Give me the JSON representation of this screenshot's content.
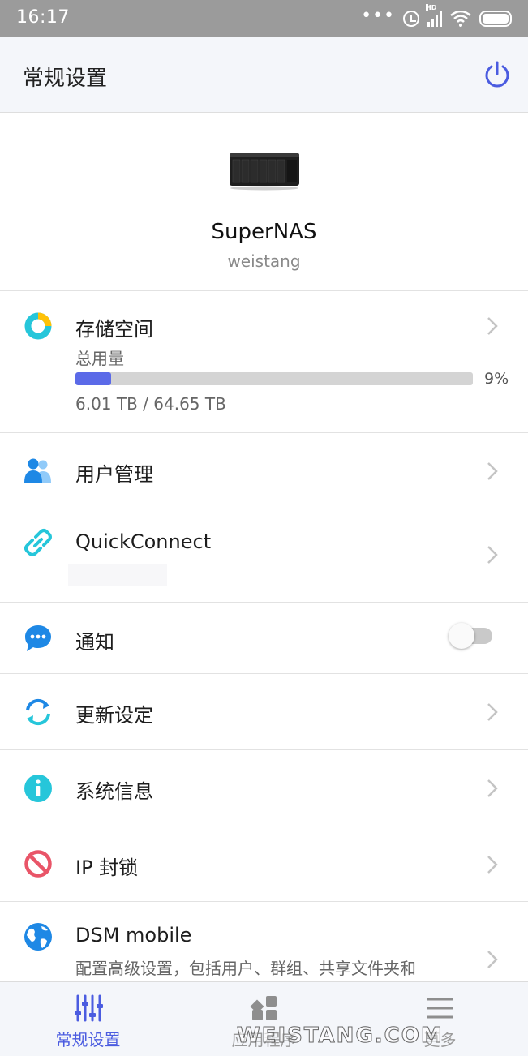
{
  "status_bar": {
    "time": "16:17",
    "hd_label": "HD",
    "dots": "•••"
  },
  "header": {
    "title": "常规设置"
  },
  "device": {
    "name": "SuperNAS",
    "user": "weistang"
  },
  "storage": {
    "label": "存储空间",
    "sub_label": "总用量",
    "used_fraction": 0.09,
    "percent_text": "9%",
    "usage_text": "6.01 TB / 64.65 TB"
  },
  "rows": {
    "users": {
      "label": "用户管理"
    },
    "quickconnect": {
      "label": "QuickConnect"
    },
    "notifications": {
      "label": "通知",
      "enabled": false
    },
    "update": {
      "label": "更新设定"
    },
    "sysinfo": {
      "label": "系统信息"
    },
    "ipblock": {
      "label": "IP 封锁"
    },
    "dsm": {
      "label": "DSM mobile",
      "description": "配置高级设置，包括用户、群组、共享文件夹和"
    }
  },
  "bottom_nav": {
    "tabs": [
      {
        "label": "常规设置",
        "active": true
      },
      {
        "label": "应用程序",
        "active": false
      },
      {
        "label": "更多",
        "active": false
      }
    ]
  },
  "watermark": "WEISTANG.COM",
  "colors": {
    "accent": "#4b5ce0",
    "storage_fill": "#5b6ae8",
    "icon_blue": "#1e88e5",
    "icon_cyan": "#26c6da",
    "icon_red": "#e95568",
    "status_bar_bg": "#9b9b9b"
  }
}
